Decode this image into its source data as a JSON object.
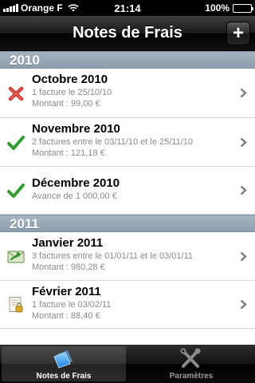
{
  "status_bar": {
    "carrier": "Orange F",
    "time": "21:14",
    "battery": "100%"
  },
  "nav": {
    "title": "Notes de Frais",
    "add_label": "+"
  },
  "sections": [
    {
      "header": "2010",
      "rows": [
        {
          "title": "Octobre 2010",
          "lines": [
            "1 facture le 25/10/10",
            "Montant : 99,00 €"
          ],
          "status_icon": "red-cross-icon"
        },
        {
          "title": "Novembre 2010",
          "lines": [
            "2 factures entre le 03/11/10 et le 25/11/10",
            "Montant : 121,18 €"
          ],
          "status_icon": "green-check-icon"
        },
        {
          "title": "Décembre 2010",
          "lines": [
            "Avance de 1 000,00 €"
          ],
          "status_icon": "green-check-icon"
        }
      ]
    },
    {
      "header": "2011",
      "rows": [
        {
          "title": "Janvier 2011",
          "lines": [
            "3 factures entre le 01/01/11 et le 03/01/11",
            "Montant : 980,28 €"
          ],
          "status_icon": "send-mail-icon"
        },
        {
          "title": "Février 2011",
          "lines": [
            "1 facture le 03/02/11",
            "Montant : 88,40 €"
          ],
          "status_icon": "document-lock-icon"
        }
      ]
    }
  ],
  "tabs": [
    {
      "label": "Notes de Frais",
      "icon": "notes-icon",
      "active": true
    },
    {
      "label": "Paramètres",
      "icon": "tools-icon",
      "active": false
    }
  ]
}
